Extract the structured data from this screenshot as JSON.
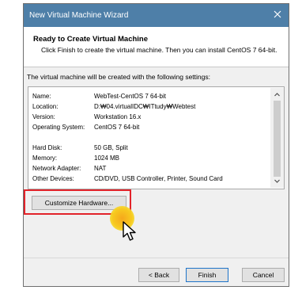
{
  "window": {
    "title": "New Virtual Machine Wizard",
    "close_icon": "close-icon"
  },
  "header": {
    "title": "Ready to Create Virtual Machine",
    "subtitle": "Click Finish to create the virtual machine. Then you can install CentOS 7 64-bit."
  },
  "intro_text": "The virtual machine will be created with the following settings:",
  "settings": [
    {
      "key": "Name:",
      "value": "WebTest-CentOS 7 64-bit"
    },
    {
      "key": "Location:",
      "value": "D:₩04.virtualIDC₩ITtudy₩Webtest"
    },
    {
      "key": "Version:",
      "value": "Workstation 16.x"
    },
    {
      "key": "Operating System:",
      "value": "CentOS 7 64-bit"
    },
    {
      "key": "Hard Disk:",
      "value": "50 GB, Split"
    },
    {
      "key": "Memory:",
      "value": "1024 MB"
    },
    {
      "key": "Network Adapter:",
      "value": "NAT"
    },
    {
      "key": "Other Devices:",
      "value": "CD/DVD, USB Controller, Printer, Sound Card"
    }
  ],
  "buttons": {
    "customize": "Customize Hardware...",
    "back": "< Back",
    "finish": "Finish",
    "cancel": "Cancel"
  },
  "colors": {
    "titlebar": "#4e7fa8",
    "highlight": "#e2232a",
    "cursor_marker": "#f7c91f",
    "finish_border": "#1e74c9"
  }
}
